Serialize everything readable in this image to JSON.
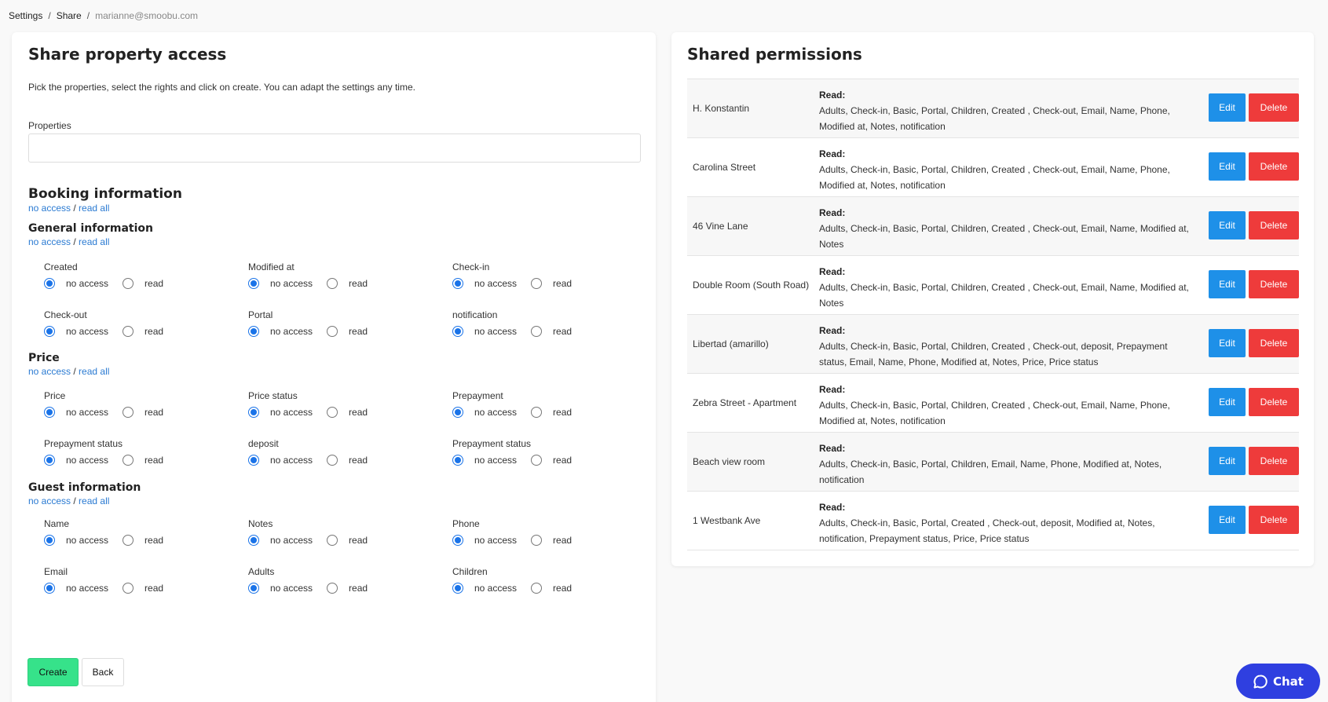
{
  "breadcrumb": {
    "settings": "Settings",
    "share": "Share",
    "account": "marianne@smoobu.com"
  },
  "left": {
    "title": "Share property access",
    "description": "Pick the properties, select the rights and click on create. You can adapt the settings any time.",
    "properties_label": "Properties",
    "properties_value": "",
    "no_access_link": "no access",
    "read_all_link": "read all",
    "opt_no_access": "no access",
    "opt_read": "read",
    "booking_title": "Booking information",
    "general_title": "General information",
    "general_items": [
      "Created",
      "Modified at",
      "Check-in",
      "Check-out",
      "Portal",
      "notification"
    ],
    "price_title": "Price",
    "price_items": [
      "Price",
      "Price status",
      "Prepayment",
      "Prepayment status",
      "deposit",
      "Prepayment status"
    ],
    "guest_title": "Guest information",
    "guest_items": [
      "Name",
      "Notes",
      "Phone",
      "Email",
      "Adults",
      "Children"
    ],
    "create_label": "Create",
    "back_label": "Back"
  },
  "right": {
    "title": "Shared permissions",
    "read_label": "Read:",
    "edit_label": "Edit",
    "delete_label": "Delete",
    "rows": [
      {
        "name": "H. Konstantin",
        "rights": "Adults, Check-in, Basic, Portal, Children, Created , Check-out, Email, Name, Phone, Modified at, Notes, notification"
      },
      {
        "name": "Carolina Street",
        "rights": "Adults, Check-in, Basic, Portal, Children, Created , Check-out, Email, Name, Phone, Modified at, Notes, notification"
      },
      {
        "name": "46 Vine Lane",
        "rights": "Adults, Check-in, Basic, Portal, Children, Created , Check-out, Email, Name, Modified at, Notes"
      },
      {
        "name": "Double Room (South Road)",
        "rights": "Adults, Check-in, Basic, Portal, Children, Created , Check-out, Email, Name, Modified at, Notes"
      },
      {
        "name": "Libertad (amarillo)",
        "rights": "Adults, Check-in, Basic, Portal, Children, Created , Check-out, deposit, Prepayment status, Email, Name, Phone, Modified at, Notes, Price, Price status"
      },
      {
        "name": "Zebra Street - Apartment",
        "rights": "Adults, Check-in, Basic, Portal, Children, Created , Check-out, Email, Name, Phone, Modified at, Notes, notification"
      },
      {
        "name": "Beach view room",
        "rights": "Adults, Check-in, Basic, Portal, Children, Email, Name, Phone, Modified at, Notes, notification"
      },
      {
        "name": "1 Westbank Ave",
        "rights": "Adults, Check-in, Basic, Portal, Created , Check-out, deposit, Modified at, Notes, notification, Prepayment status, Price, Price status"
      }
    ]
  },
  "chat": {
    "label": "Chat"
  },
  "colors": {
    "accent_blue": "#1a73e8",
    "create_green": "#36e28a",
    "edit_blue": "#1e90e8",
    "delete_red": "#ee3b3b",
    "chat_blue": "#2f3fe0"
  }
}
